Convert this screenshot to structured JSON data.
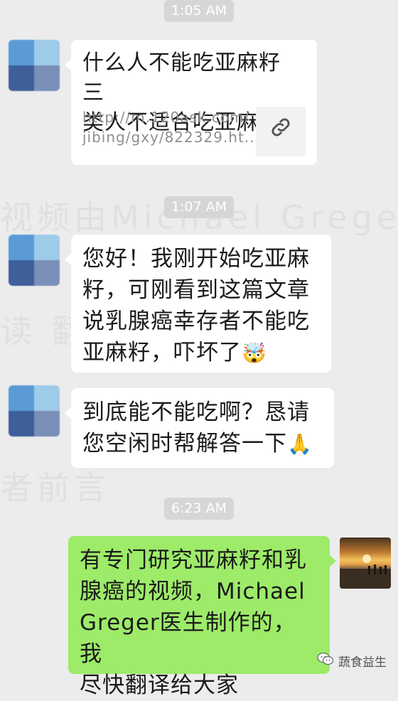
{
  "watermark_lines": [
    "视频由Michael Greger 医生",
    "读 翻译 阿觉",
    "者前言"
  ],
  "messages": {
    "t1": "1:05 AM",
    "link_card": {
      "title_line1": "什么人不能吃亚麻籽 三",
      "title_line2": "类人不适合吃亚麻籽...",
      "url_line1": "http://m.120ask.com/",
      "url_line2": "jibing/gxy/822329.ht...",
      "thumb_icon": "link-icon"
    },
    "t2": "1:07 AM",
    "msg2": {
      "line1": "您好！我刚开始吃亚麻",
      "line2": "籽，可刚看到这篇文章",
      "line3": "说乳腺癌幸存者不能吃",
      "line4": "亚麻籽，吓坏了",
      "emoji": "🤯"
    },
    "msg3": {
      "line1": "到底能不能吃啊？恳请",
      "line2": "您空闲时帮解答一下",
      "emoji": "🙏"
    },
    "t3": "6:23 AM",
    "msg4": {
      "line1": "有专门研究亚麻籽和乳",
      "line2": "腺癌的视频，Michael",
      "line3": "Greger医生制作的，我",
      "line4": "尽快翻译给大家"
    }
  },
  "brand": {
    "label": "蔬食益生",
    "icon": "wechat-icon"
  },
  "colors": {
    "background": "#ececec",
    "sent_bubble": "#9deb69",
    "received_bubble": "#ffffff",
    "time_pill": "#d6d6d6"
  }
}
